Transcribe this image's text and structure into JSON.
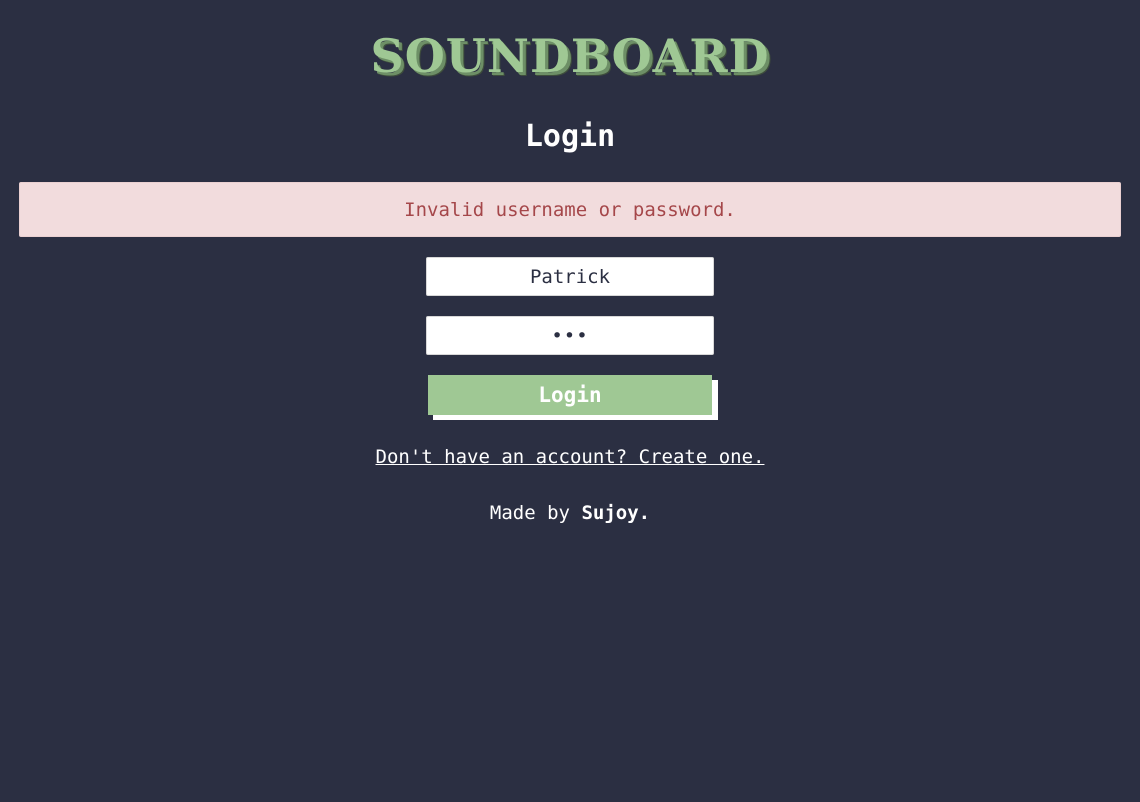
{
  "app": {
    "logo_text": "SOUNDBOARD"
  },
  "page": {
    "title": "Login"
  },
  "alert": {
    "message": "Invalid username or password."
  },
  "form": {
    "username_value": "Patrick",
    "password_value": "abc",
    "login_label": "Login"
  },
  "signup": {
    "link_text": "Don't have an account? Create one."
  },
  "footer": {
    "prefix": "Made by ",
    "author": "Sujoy."
  },
  "colors": {
    "background": "#2b2f42",
    "accent": "#9fc894",
    "alert_background": "#f2dcdd",
    "alert_text": "#a5474a"
  }
}
